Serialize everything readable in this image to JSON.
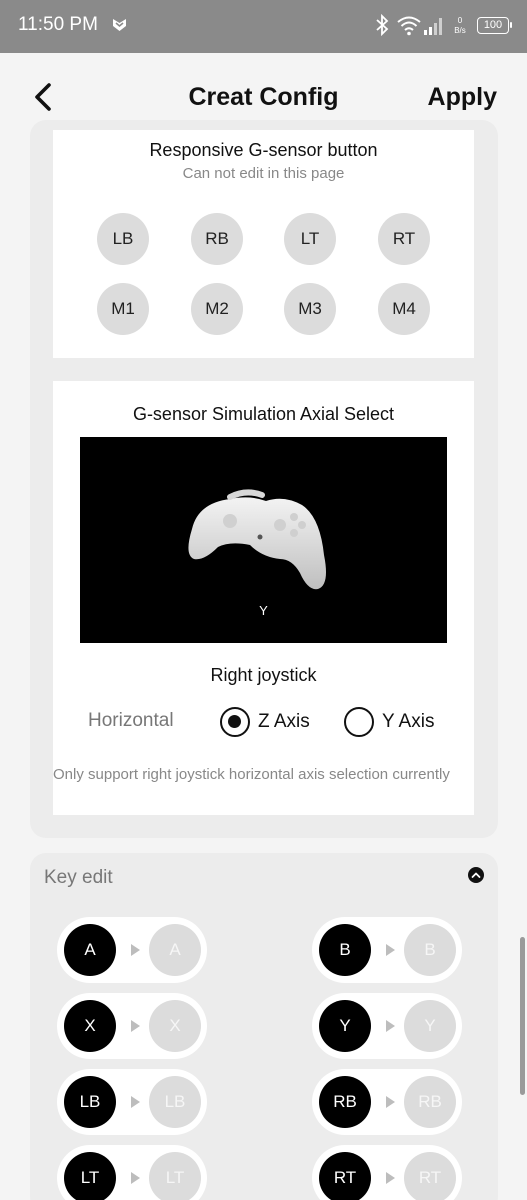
{
  "status_bar": {
    "time": "11:50 PM",
    "speed_value": "0",
    "speed_unit": "B/s",
    "battery": "100"
  },
  "header": {
    "title": "Creat Config",
    "apply_label": "Apply"
  },
  "responsive_panel": {
    "title": "Responsive G-sensor button",
    "subtitle": "Can not edit in this page",
    "buttons": [
      "LB",
      "RB",
      "LT",
      "RT",
      "M1",
      "M2",
      "M3",
      "M4"
    ]
  },
  "axial_panel": {
    "title": "G-sensor Simulation Axial Select",
    "preview_axis_label": "Y",
    "joystick_label": "Right joystick",
    "direction_label": "Horizontal",
    "options": [
      {
        "label": "Z Axis",
        "selected": true
      },
      {
        "label": "Y Axis",
        "selected": false
      }
    ],
    "note": "Only support right joystick horizontal axis selection currently"
  },
  "key_edit": {
    "title": "Key edit",
    "pairs": [
      {
        "from": "A",
        "to": "A"
      },
      {
        "from": "B",
        "to": "B"
      },
      {
        "from": "X",
        "to": "X"
      },
      {
        "from": "Y",
        "to": "Y"
      },
      {
        "from": "LB",
        "to": "LB"
      },
      {
        "from": "RB",
        "to": "RB"
      },
      {
        "from": "LT",
        "to": "LT"
      },
      {
        "from": "RT",
        "to": "RT"
      }
    ]
  },
  "colors": {
    "status_bar": "#8a8a8a",
    "page_background": "#f4f4f4",
    "card_background": "#ececec",
    "key_source": "#000000",
    "key_target": "#dcdcdc"
  }
}
